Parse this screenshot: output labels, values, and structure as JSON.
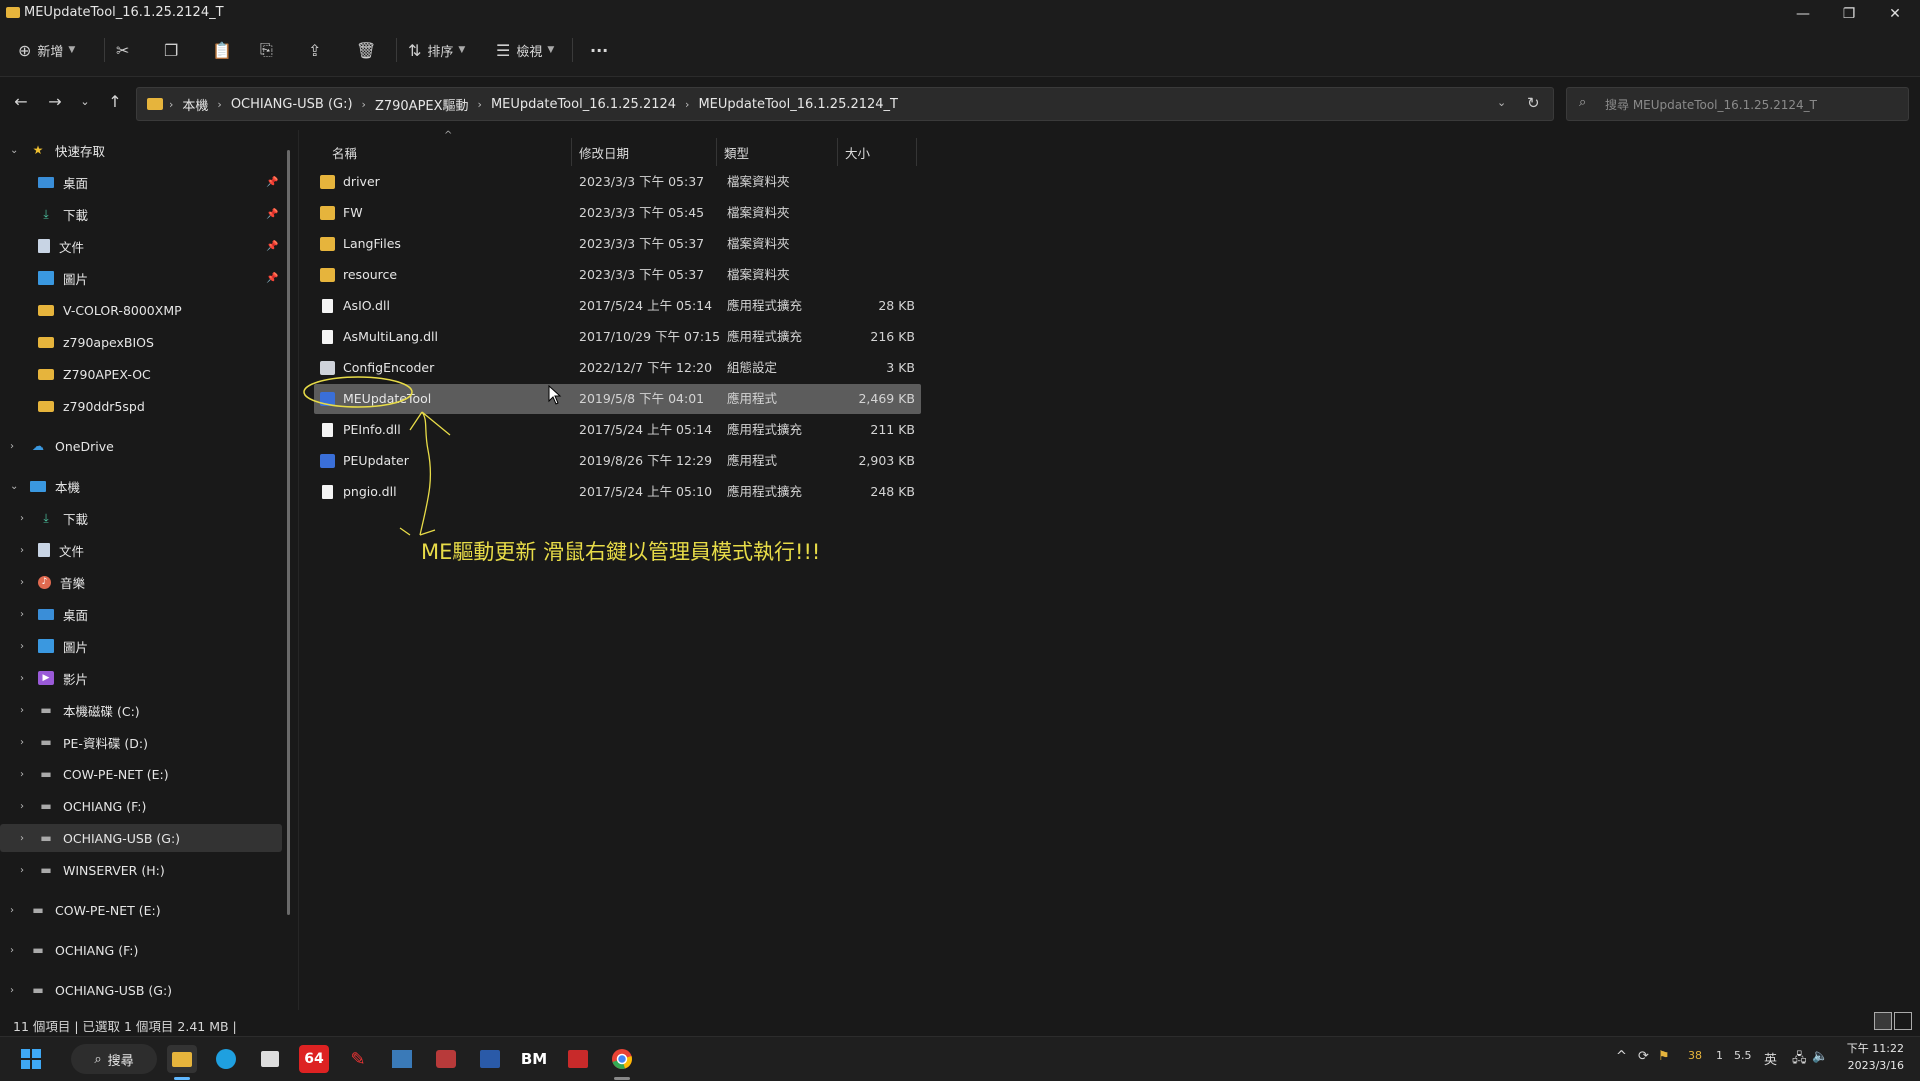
{
  "window": {
    "title": "MEUpdateTool_16.1.25.2124_T",
    "minimize": "—",
    "maximize": "❐",
    "close": "✕"
  },
  "toolbar": {
    "new_label": "新增",
    "sort_label": "排序",
    "view_label": "檢視",
    "more_label": "···"
  },
  "address": {
    "crumbs": [
      "本機",
      "OCHIANG-USB (G:)",
      "Z790APEX驅動",
      "MEUpdateTool_16.1.25.2124",
      "MEUpdateTool_16.1.25.2124_T"
    ]
  },
  "search": {
    "placeholder": "搜尋 MEUpdateTool_16.1.25.2124_T"
  },
  "nav": {
    "quick_access": "快速存取",
    "pinned": [
      "桌面",
      "下載",
      "文件",
      "圖片"
    ],
    "recent": [
      "V-COLOR-8000XMP",
      "z790apexBIOS",
      "Z790APEX-OC",
      "z790ddr5spd"
    ],
    "onedrive": "OneDrive",
    "this_pc": "本機",
    "pc_items": [
      "下載",
      "文件",
      "音樂",
      "桌面",
      "圖片",
      "影片",
      "本機磁碟 (C:)",
      "PE-資料碟 (D:)",
      "COW-PE-NET (E:)",
      "OCHIANG (F:)",
      "OCHIANG-USB (G:)",
      "WINSERVER (H:)"
    ],
    "drives": [
      "COW-PE-NET (E:)",
      "OCHIANG (F:)",
      "OCHIANG-USB (G:)"
    ]
  },
  "columns": {
    "name": "名稱",
    "date": "修改日期",
    "type": "類型",
    "size": "大小"
  },
  "files": [
    {
      "name": "driver",
      "date": "2023/3/3 下午 05:37",
      "type": "檔案資料夾",
      "size": "",
      "kind": "folder"
    },
    {
      "name": "FW",
      "date": "2023/3/3 下午 05:45",
      "type": "檔案資料夾",
      "size": "",
      "kind": "folder"
    },
    {
      "name": "LangFiles",
      "date": "2023/3/3 下午 05:37",
      "type": "檔案資料夾",
      "size": "",
      "kind": "folder"
    },
    {
      "name": "resource",
      "date": "2023/3/3 下午 05:37",
      "type": "檔案資料夾",
      "size": "",
      "kind": "folder"
    },
    {
      "name": "AsIO.dll",
      "date": "2017/5/24 上午 05:14",
      "type": "應用程式擴充",
      "size": "28 KB",
      "kind": "file"
    },
    {
      "name": "AsMultiLang.dll",
      "date": "2017/10/29 下午 07:15",
      "type": "應用程式擴充",
      "size": "216 KB",
      "kind": "file"
    },
    {
      "name": "ConfigEncoder",
      "date": "2022/12/7 下午 12:20",
      "type": "組態設定",
      "size": "3 KB",
      "kind": "gear"
    },
    {
      "name": "MEUpdateTool",
      "date": "2019/5/8 下午 04:01",
      "type": "應用程式",
      "size": "2,469 KB",
      "kind": "app"
    },
    {
      "name": "PEInfo.dll",
      "date": "2017/5/24 上午 05:14",
      "type": "應用程式擴充",
      "size": "211 KB",
      "kind": "file"
    },
    {
      "name": "PEUpdater",
      "date": "2019/8/26 下午 12:29",
      "type": "應用程式",
      "size": "2,903 KB",
      "kind": "app"
    },
    {
      "name": "pngio.dll",
      "date": "2017/5/24 上午 05:10",
      "type": "應用程式擴充",
      "size": "248 KB",
      "kind": "file"
    }
  ],
  "selected_file": "MEUpdateTool",
  "annotation": "ME驅動更新 滑鼠右鍵以管理員模式執行!!!",
  "annotation_color": "#e8dc48",
  "status": "11 個項目  |  已選取 1 個項目 2.41 MB  |",
  "taskbar": {
    "search_label": "搜尋",
    "app_64": "64",
    "app_bm": "BM",
    "tray_badge": "38",
    "tray_num1": "1",
    "tray_num2": "5.5",
    "ime": "英",
    "time": "下午 11:22",
    "date": "2023/3/16"
  }
}
